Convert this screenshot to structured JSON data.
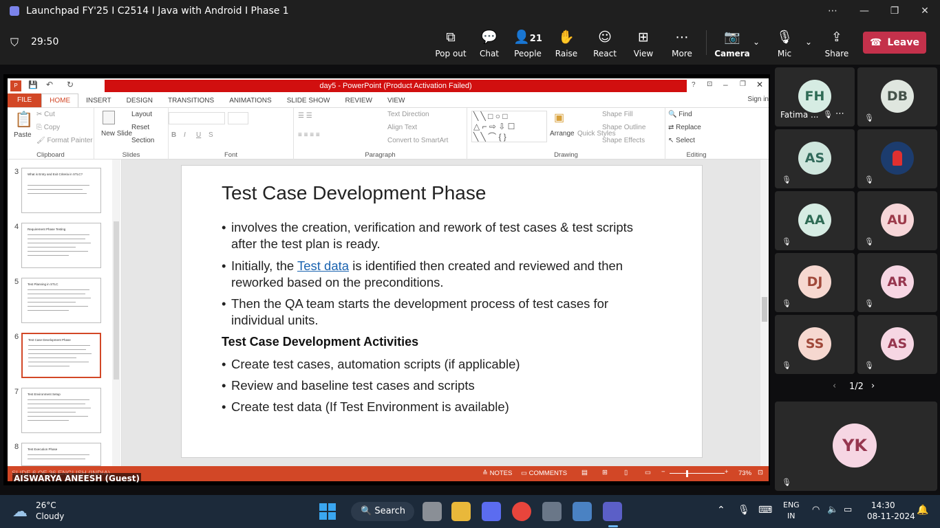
{
  "window": {
    "title": "Launchpad FY'25 I C2514 I Java with Android I Phase 1"
  },
  "meeting": {
    "timer": "29:50",
    "people_count": "21",
    "buttons": {
      "pop_out": "Pop out",
      "chat": "Chat",
      "people": "People",
      "raise": "Raise",
      "react": "React",
      "view": "View",
      "more": "More",
      "camera": "Camera",
      "mic": "Mic",
      "share": "Share",
      "leave": "Leave"
    }
  },
  "ppt": {
    "title": "day5  -  PowerPoint (Product Activation Failed)",
    "signin": "Sign in",
    "tabs": [
      "FILE",
      "HOME",
      "INSERT",
      "DESIGN",
      "TRANSITIONS",
      "ANIMATIONS",
      "SLIDE SHOW",
      "REVIEW",
      "VIEW"
    ],
    "ribbon": {
      "paste": "Paste",
      "cut": "Cut",
      "copy": "Copy",
      "format_painter": "Format Painter",
      "new_slide": "New Slide",
      "layout": "Layout",
      "reset": "Reset",
      "section": "Section",
      "text_direction": "Text Direction",
      "align_text": "Align Text",
      "smartart": "Convert to SmartArt",
      "arrange": "Arrange",
      "quick_styles": "Quick Styles",
      "shape_fill": "Shape Fill",
      "shape_outline": "Shape Outline",
      "shape_effects": "Shape Effects",
      "find": "Find",
      "replace": "Replace",
      "select": "Select",
      "groups": {
        "clipboard": "Clipboard",
        "slides": "Slides",
        "font": "Font",
        "paragraph": "Paragraph",
        "drawing": "Drawing",
        "editing": "Editing"
      }
    },
    "thumbnails": [
      {
        "num": "3",
        "title": "What is Entry and Exit Criteria in STLC?"
      },
      {
        "num": "4",
        "title": "Requirement Phase Testing"
      },
      {
        "num": "5",
        "title": "Test Planning in STLC"
      },
      {
        "num": "6",
        "title": "Test Case Development Phase"
      },
      {
        "num": "7",
        "title": "Test Environment Setup"
      },
      {
        "num": "8",
        "title": "Test Execution Phase"
      }
    ],
    "slide": {
      "title": "Test Case Development Phase",
      "b1": "involves the creation, verification and rework of test cases & test scripts after the test plan is ready.",
      "b2_pre": "Initially, the ",
      "b2_link": "Test data",
      "b2_post": " is identified then created and reviewed and then reworked based on the preconditions.",
      "b3": " Then the QA team starts the development process of test cases for individual units.",
      "subtitle": "Test Case Development Activities",
      "b4": "Create test cases, automation scripts (if applicable)",
      "b5": "Review and baseline test cases and scripts",
      "b6": "Create test data (If Test Environment is available)"
    },
    "status": {
      "left": "SLIDE 6 OF 36   ENGLISH (INDIA)",
      "notes": "NOTES",
      "comments": "COMMENTS",
      "zoom": "73%"
    }
  },
  "presenter": "AISWARYA ANEESH (Guest)",
  "participants": [
    {
      "initials": "FH",
      "name": "Fatima ...",
      "bg": "#d6ece3",
      "fg": "#2e6b55"
    },
    {
      "initials": "DB",
      "bg": "#dfe6df",
      "fg": "#45524a"
    },
    {
      "initials": "AS",
      "bg": "#cfe6dd",
      "fg": "#31695a"
    },
    {
      "initials": "",
      "bg": "#1c3c6e",
      "fg": "#fff"
    },
    {
      "initials": "AA",
      "bg": "#d6ece3",
      "fg": "#2e6b55"
    },
    {
      "initials": "AU",
      "bg": "#f6d6d8",
      "fg": "#9c3b4a"
    },
    {
      "initials": "DJ",
      "bg": "#f6d8d0",
      "fg": "#a0493a"
    },
    {
      "initials": "AR",
      "bg": "#f6d6e3",
      "fg": "#96364f"
    },
    {
      "initials": "SS",
      "bg": "#f6d8d0",
      "fg": "#a0493a"
    },
    {
      "initials": "AS",
      "bg": "#f6d6e3",
      "fg": "#96364f"
    }
  ],
  "pager": "1/2",
  "self_tile": {
    "initials": "YK"
  },
  "taskbar": {
    "weather_temp": "26°C",
    "weather_desc": "Cloudy",
    "search": "Search",
    "lang1": "ENG",
    "lang2": "IN",
    "time": "14:30",
    "date": "08-11-2024"
  }
}
